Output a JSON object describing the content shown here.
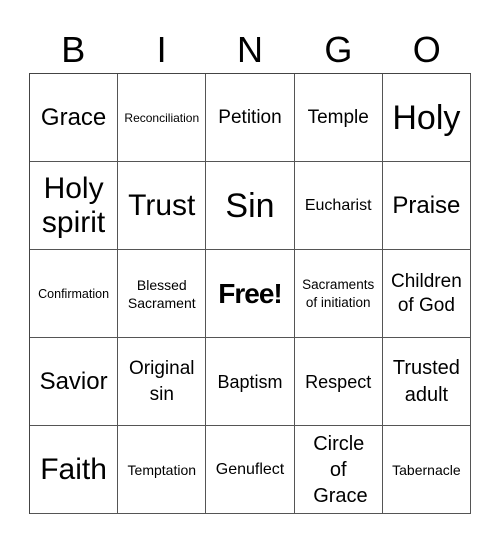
{
  "header": {
    "letters": [
      "B",
      "I",
      "N",
      "G",
      "O"
    ]
  },
  "cells": [
    [
      "Grace",
      "Reconciliation",
      "Petition",
      "Temple",
      "Holy"
    ],
    [
      "Holy spirit",
      "Trust",
      "Sin",
      "Eucharist",
      "Praise"
    ],
    [
      "Confirmation",
      "Blessed Sacrament",
      "Free!",
      "Sacraments of initiation",
      "Children of God"
    ],
    [
      "Savior",
      "Original sin",
      "Baptism",
      "Respect",
      "Trusted adult"
    ],
    [
      "Faith",
      "Temptation",
      "Genuflect",
      "Circle of Grace",
      "Tabernacle"
    ]
  ]
}
